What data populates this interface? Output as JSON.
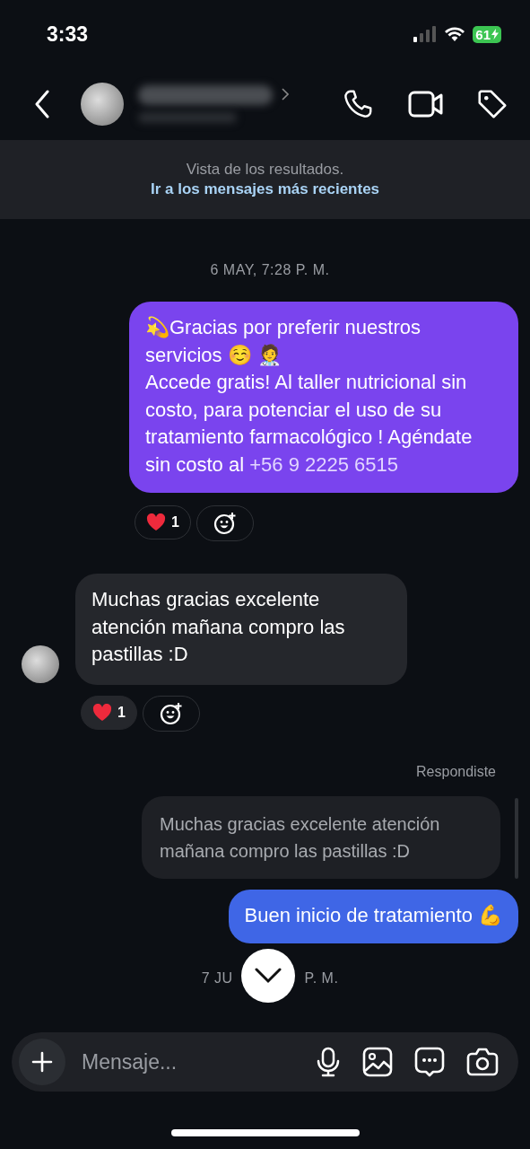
{
  "status_bar": {
    "time": "3:33",
    "battery": "61"
  },
  "banner": {
    "text": "Vista de los resultados.",
    "link": "Ir a los mensajes más recientes"
  },
  "messages": [
    {
      "kind": "date",
      "parts": [
        "6 MAY, 7:28 P. M."
      ]
    },
    {
      "kind": "sent",
      "color": "#7a44ee",
      "text": "💫Gracias por preferir nuestros servicios ☺️ 🧑‍⚕️\nAccede gratis! Al taller nutricional sin costo, para potenciar el uso de su tratamiento farmacológico ! Agéndate sin costo al",
      "link": "+56 9 2225 6515",
      "reaction_count": "1"
    },
    {
      "kind": "received",
      "text": "Muchas gracias excelente atención mañana compro las pastillas :D",
      "reaction_count": "1"
    },
    {
      "kind": "reply",
      "label": "Respondiste",
      "text": "Muchas gracias excelente atención mañana compro las pastillas :D"
    },
    {
      "kind": "sent",
      "color": "#3f66e6",
      "text": "Buen inicio de tratamiento 💪"
    },
    {
      "kind": "date",
      "parts": [
        "7 JU",
        "P. M."
      ]
    }
  ],
  "composer": {
    "placeholder": "Mensaje..."
  }
}
